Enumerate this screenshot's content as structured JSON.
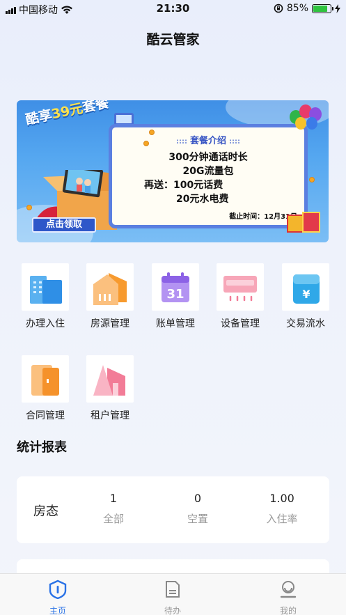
{
  "status_bar": {
    "carrier": "中国移动",
    "time": "21:30",
    "battery": "85%",
    "battery_fraction": 0.85,
    "wifi_icon": "wifi-icon",
    "signal_icon": "signal-icon",
    "lock_icon": "rotation-lock-icon",
    "charging_icon": "charging-bolt-icon"
  },
  "header": {
    "title": "酷云管家"
  },
  "banner": {
    "headline_prefix": "酷享",
    "headline_accent": "39元",
    "headline_suffix": "套餐",
    "card_title": "套餐介绍",
    "line1": "300分钟通话时长",
    "line2": "20G流量包",
    "line3": "再送：100元话费",
    "line4": "20元水电费",
    "deadline": "截止时间：12月31日",
    "claim_label": "点击领取"
  },
  "menu": {
    "items": [
      {
        "label": "办理入住",
        "icon": "building-icon"
      },
      {
        "label": "房源管理",
        "icon": "house-icon"
      },
      {
        "label": "账单管理",
        "icon": "calendar-icon"
      },
      {
        "label": "设备管理",
        "icon": "air-conditioner-icon"
      },
      {
        "label": "交易流水",
        "icon": "yuan-wallet-icon"
      },
      {
        "label": "合同管理",
        "icon": "contract-icon"
      },
      {
        "label": "租户管理",
        "icon": "tenant-house-icon"
      }
    ]
  },
  "stats": {
    "section_title": "统计报表",
    "row_label": "房态",
    "items": [
      {
        "value": "1",
        "label": "全部"
      },
      {
        "value": "0",
        "label": "空置"
      },
      {
        "value": "1.00",
        "label": "入住率"
      }
    ]
  },
  "tabbar": {
    "tabs": [
      {
        "label": "主页",
        "icon": "home-shield-icon",
        "active": true
      },
      {
        "label": "待办",
        "icon": "todo-document-icon",
        "active": false
      },
      {
        "label": "我的",
        "icon": "profile-icon",
        "active": false
      }
    ]
  },
  "colors": {
    "accent": "#2a72e6",
    "banner_blue": "#3f8fe6",
    "battery_green": "#2fc33f"
  }
}
